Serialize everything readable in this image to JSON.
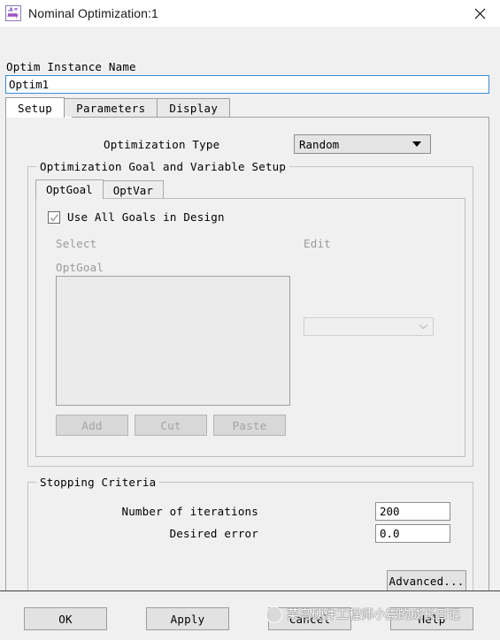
{
  "window": {
    "title": "Nominal Optimization:1",
    "icon": "waveform-circuit-icon",
    "close_label": "✕"
  },
  "instance": {
    "label": "Optim Instance Name",
    "value": "Optim1",
    "placeholder": ""
  },
  "tabs": [
    {
      "label": "Setup",
      "active": true
    },
    {
      "label": "Parameters",
      "active": false
    },
    {
      "label": "Display",
      "active": false
    }
  ],
  "setup": {
    "optimization_type": {
      "label": "Optimization Type",
      "value": "Random",
      "options": [
        "Random"
      ]
    },
    "goal_group": {
      "title": "Optimization Goal and Variable Setup",
      "inner_tabs": [
        {
          "label": "OptGoal",
          "active": true
        },
        {
          "label": "OptVar",
          "active": false
        }
      ],
      "use_all_goals": {
        "label": "Use All Goals in Design",
        "checked": true
      },
      "select_label": "Select",
      "edit_label": "Edit",
      "list_label": "OptGoal",
      "list_items": [],
      "edit_combo_value": "",
      "buttons": [
        {
          "label": "Add",
          "enabled": false
        },
        {
          "label": "Cut",
          "enabled": false
        },
        {
          "label": "Paste",
          "enabled": false
        }
      ]
    },
    "stopping_criteria": {
      "title": "Stopping Criteria",
      "iterations_label": "Number of iterations",
      "iterations_value": "200",
      "error_label": "Desired error",
      "error_value": "0.0",
      "advanced_label": "Advanced..."
    }
  },
  "footer": {
    "ok": "OK",
    "apply": "Apply",
    "cancel": "Cancel",
    "help": "Help"
  },
  "watermark": {
    "text": "菜鸟硬件工程师小震的成长日记"
  },
  "colors": {
    "accent": "#3c8ad4",
    "dialog_bg": "#f0f0f0",
    "button_bg": "#e2e2e2",
    "disabled_text": "#a3a3a3",
    "icon_purple": "#8b5fbf"
  }
}
